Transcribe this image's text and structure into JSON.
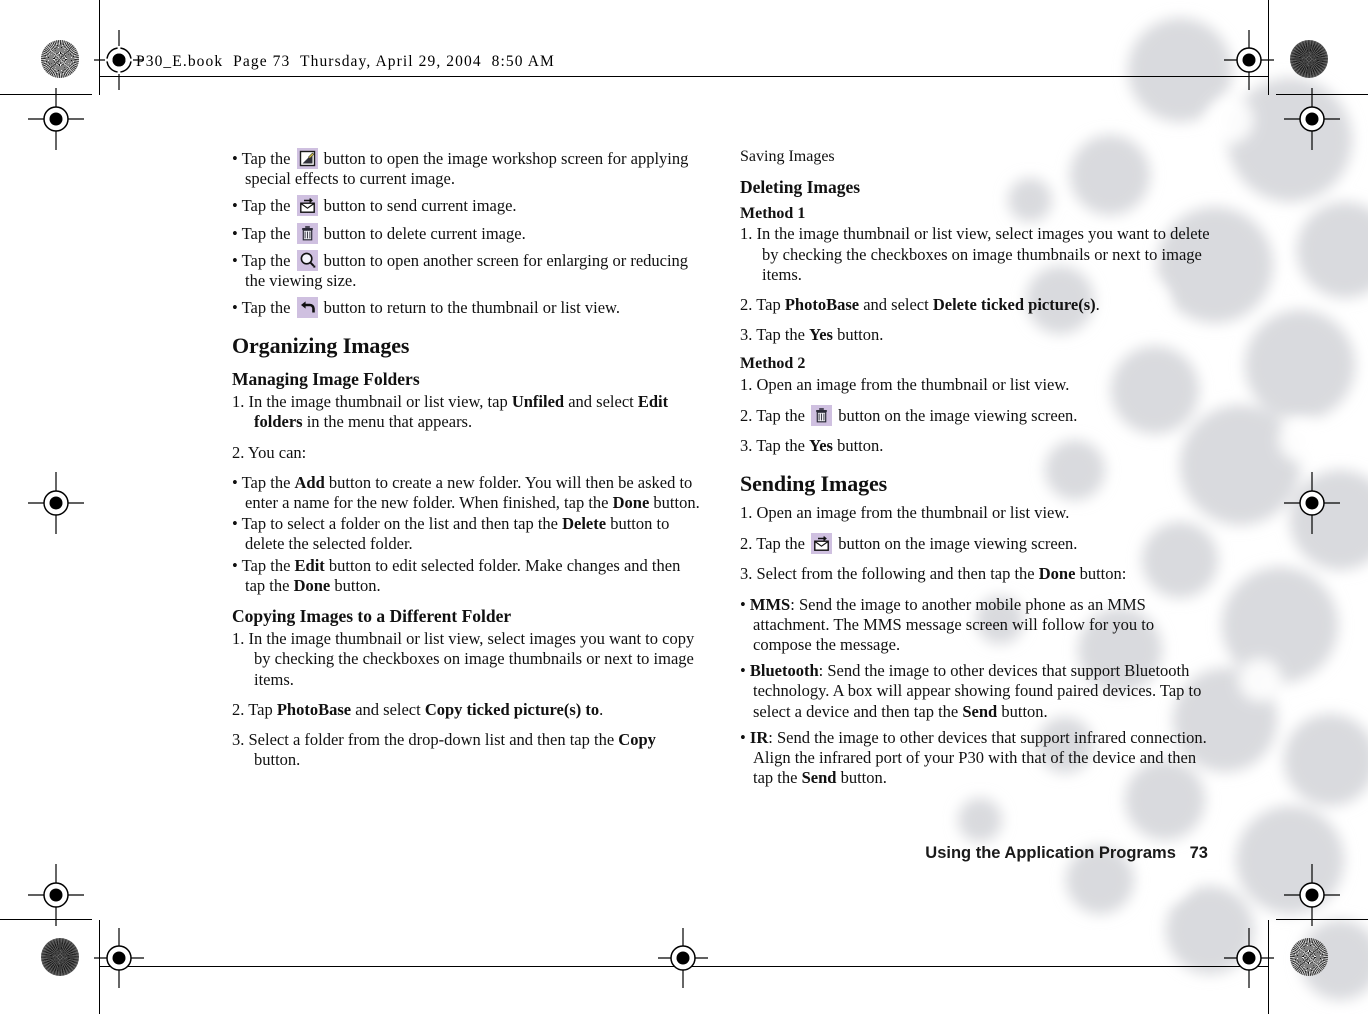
{
  "document": {
    "header_line": "P30_E.book  Page 73  Thursday, April 29, 2004  8:50 AM",
    "footer_text": "Using the Application Programs   73",
    "page_number": "73"
  },
  "colors": {
    "icon_chip_background": "#cfc0e0",
    "text": "#111111",
    "page_background": "#ffffff"
  },
  "left_column": {
    "viewing_bullets": [
      {
        "icon": "image-workshop-icon",
        "pre": "• Tap the",
        "post": "button to open the image workshop screen for applying special effects to current image."
      },
      {
        "icon": "send-envelope-icon",
        "pre": "• Tap the",
        "post": "button to send current image."
      },
      {
        "icon": "trash-can-icon",
        "pre": "• Tap the",
        "post": "button to delete current image."
      },
      {
        "icon": "magnifier-icon",
        "pre": "• Tap the",
        "post": "button to open another screen for enlarging or reducing the viewing size."
      },
      {
        "icon": "back-arrow-icon",
        "pre": "• Tap the",
        "post": "button to return to the thumbnail or list view."
      }
    ],
    "organizing_images_heading": "Organizing Images",
    "managing_image_folders_heading": "Managing Image Folders",
    "managing_step_1": {
      "number": "1.",
      "text_a": "In the image thumbnail or list view, tap ",
      "bold_a": "Unfiled",
      "text_b": " and select ",
      "bold_b": "Edit folders",
      "text_c": " in the menu that appears."
    },
    "managing_step_2": "2. You can:",
    "managing_bullets": [
      {
        "text_a": "• Tap the ",
        "bold_a": "Add",
        "text_b": " button to create a new folder. You will then be asked to enter a name for the new folder. When finished, tap the ",
        "bold_b": "Done",
        "text_c": " button."
      },
      {
        "text_a": "•  Tap to select a folder on the list and then tap the ",
        "bold_a": "Delete",
        "text_b": " button to delete the selected folder.",
        "bold_b": "",
        "text_c": ""
      },
      {
        "text_a": "• Tap the ",
        "bold_a": "Edit",
        "text_b": " button to edit selected folder. Make changes and then tap the ",
        "bold_b": "Done",
        "text_c": " button."
      }
    ],
    "copying_heading": "Copying Images to a Different Folder",
    "copying_step_1": "1. In the image thumbnail or list view, select images you want to copy by checking the checkboxes on image thumbnails or next to image items.",
    "copying_step_2": {
      "text_a": "2. Tap ",
      "bold_a": "PhotoBase",
      "text_b": " and select ",
      "bold_b": "Copy ticked picture(s) to",
      "text_c": "."
    },
    "copying_step_3": {
      "text_a": "3. Select a folder from the drop-down list and then tap the ",
      "bold_a": "Copy",
      "text_b": " button."
    }
  },
  "right_column": {
    "saving_images_heading": "Saving Images",
    "deleting_images_heading": "Deleting Images",
    "method_1_heading": "Method 1",
    "method_1_step_1": "1. In the image thumbnail or list view, select images you want to delete by checking the checkboxes on image thumbnails or next to image items.",
    "method_1_step_2": {
      "text_a": "2. Tap ",
      "bold_a": "PhotoBase",
      "text_b": " and select ",
      "bold_b": "Delete ticked picture(s)",
      "text_c": "."
    },
    "method_1_step_3": {
      "text_a": "3. Tap the ",
      "bold_a": "Yes",
      "text_b": " button."
    },
    "method_2_heading": "Method 2",
    "method_2_step_1": "1. Open an image from the thumbnail or list view.",
    "method_2_step_2": {
      "pre": "2. Tap the",
      "icon": "trash-can-icon",
      "post": "button on the image viewing screen."
    },
    "method_2_step_3": {
      "text_a": "3. Tap the ",
      "bold_a": "Yes",
      "text_b": " button."
    },
    "sending_images_heading": "Sending Images",
    "sending_step_1": "1. Open an image from the thumbnail or list view.",
    "sending_step_2": {
      "pre": "2. Tap the",
      "icon": "send-envelope-icon",
      "post": "button on the image viewing screen."
    },
    "sending_step_3": {
      "text_a": "3. Select from the following and then tap the ",
      "bold_a": "Done",
      "text_b": " button:"
    },
    "sending_options": [
      {
        "label": "MMS",
        "text_a": ": Send the image to another mobile phone as an MMS attachment. The MMS message screen will follow for you to compose the message.",
        "bold_b": "",
        "text_b": ""
      },
      {
        "label": "Bluetooth",
        "text_a": ": Send the image to other devices that support Bluetooth technology. A box will appear showing found paired devices. Tap to select a device and then tap the ",
        "bold_b": "Send",
        "text_b": " button."
      },
      {
        "label": "IR",
        "text_a": ": Send the image to other devices that support infrared connection. Align the infrared port of your P30 with that of the device and then tap the ",
        "bold_b": "Send",
        "text_b": " button."
      }
    ]
  },
  "print_marks": {
    "registration_mark_name": "registration-target-mark",
    "rosette_name": "color-rosette-mark",
    "crop_line_name": "crop-line"
  }
}
